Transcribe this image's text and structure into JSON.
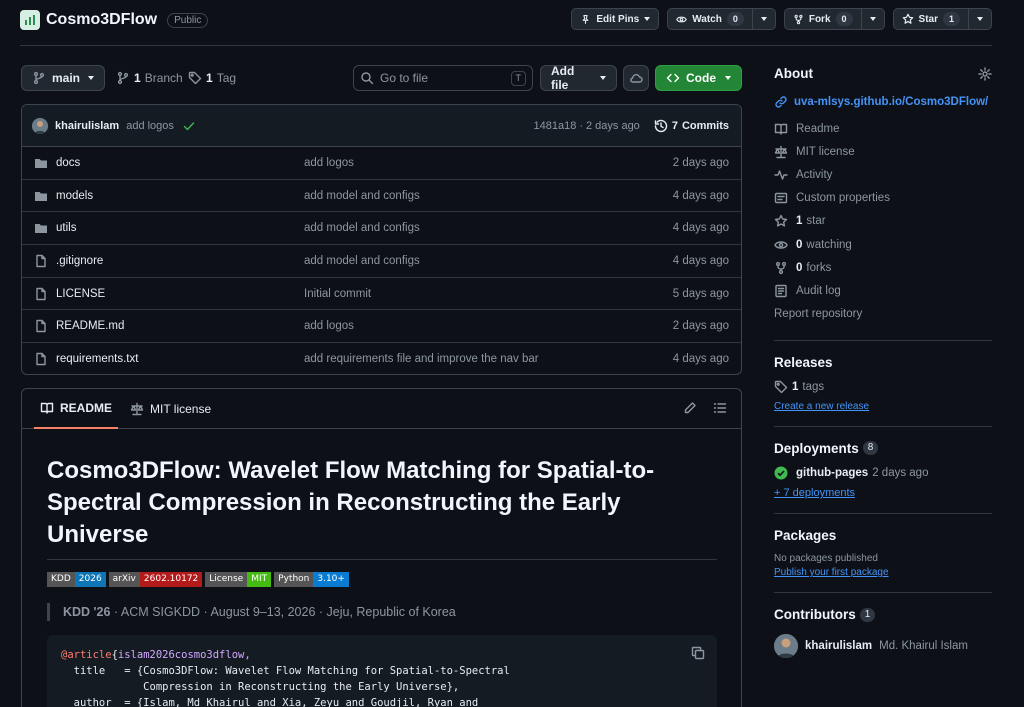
{
  "repo": {
    "name": "Cosmo3DFlow",
    "visibility": "Public"
  },
  "header_actions": {
    "edit_pins": "Edit Pins",
    "watch": {
      "label": "Watch",
      "count": "0"
    },
    "fork": {
      "label": "Fork",
      "count": "0"
    },
    "star": {
      "label": "Star",
      "count": "1"
    }
  },
  "toolbar": {
    "branch": "main",
    "branches": {
      "count": "1",
      "label": "Branch"
    },
    "tags": {
      "count": "1",
      "label": "Tag"
    },
    "search_placeholder": "Go to file",
    "search_shortcut": "T",
    "add_file": "Add file",
    "code": "Code"
  },
  "latest_commit": {
    "author": "khairulislam",
    "message": "add logos",
    "hash": "1481a18",
    "time": "2 days ago",
    "commits_count": "7",
    "commits_label": "Commits"
  },
  "files": [
    {
      "type": "dir",
      "name": "docs",
      "message": "add logos",
      "date": "2 days ago"
    },
    {
      "type": "dir",
      "name": "models",
      "message": "add model and configs",
      "date": "4 days ago"
    },
    {
      "type": "dir",
      "name": "utils",
      "message": "add model and configs",
      "date": "4 days ago"
    },
    {
      "type": "file",
      "name": ".gitignore",
      "message": "add model and configs",
      "date": "4 days ago"
    },
    {
      "type": "file",
      "name": "LICENSE",
      "message": "Initial commit",
      "date": "5 days ago"
    },
    {
      "type": "file",
      "name": "README.md",
      "message": "add logos",
      "date": "2 days ago"
    },
    {
      "type": "file",
      "name": "requirements.txt",
      "message": "add requirements file and improve the nav bar",
      "date": "4 days ago"
    }
  ],
  "readme": {
    "tabs": {
      "readme": "README",
      "license": "MIT license"
    },
    "title": "Cosmo3DFlow: Wavelet Flow Matching for Spatial-to-Spectral Compression in Reconstructing the Early Universe",
    "shields": [
      {
        "label": "KDD",
        "value": "2026",
        "color": "#0e75b6"
      },
      {
        "label": "arXiv",
        "value": "2602.10172",
        "color": "#b31b1b"
      },
      {
        "label": "License",
        "value": "MIT",
        "color": "#4c1"
      },
      {
        "label": "Python",
        "value": "3.10+",
        "color": "#0a7bd3"
      }
    ],
    "venue": {
      "bold": "KDD '26",
      "rest": " · ACM SIGKDD · August 9–13, 2026 · Jeju, Republic of Korea"
    },
    "bibtex": {
      "line1_kw": "@article",
      "line1_key": "islam2026cosmo3dflow,",
      "line2": "  title   = {Cosmo3DFlow: Wavelet Flow Matching for Spatial-to-Spectral",
      "line3": "             Compression in Reconstructing the Early Universe},",
      "line4": "  author  = {Islam, Md Khairul and Xia, Zeyu and Goudjil, Ryan and"
    }
  },
  "about": {
    "heading": "About",
    "website": "uva-mlsys.github.io/Cosmo3DFlow/",
    "readme": "Readme",
    "license": "MIT license",
    "activity": "Activity",
    "custom_properties": "Custom properties",
    "stars": {
      "count": "1",
      "label": "star"
    },
    "watching": {
      "count": "0",
      "label": "watching"
    },
    "forks": {
      "count": "0",
      "label": "forks"
    },
    "audit_log": "Audit log",
    "report": "Report repository"
  },
  "releases": {
    "heading": "Releases",
    "tags_count": "1",
    "tags_label": "tags",
    "create_link": "Create a new release"
  },
  "deployments": {
    "heading": "Deployments",
    "count": "8",
    "item": {
      "name": "github-pages",
      "time": "2 days ago"
    },
    "more": "+ 7 deployments"
  },
  "packages": {
    "heading": "Packages",
    "text": "No packages published",
    "link": "Publish your first package"
  },
  "contributors": {
    "heading": "Contributors",
    "count": "1",
    "user": "khairulislam",
    "fullname": "Md. Khairul Islam"
  },
  "colors": {
    "accent": "#4493f8",
    "code_button": "#238636",
    "bg": "#0d1117",
    "tab_underline": "#f78166"
  }
}
